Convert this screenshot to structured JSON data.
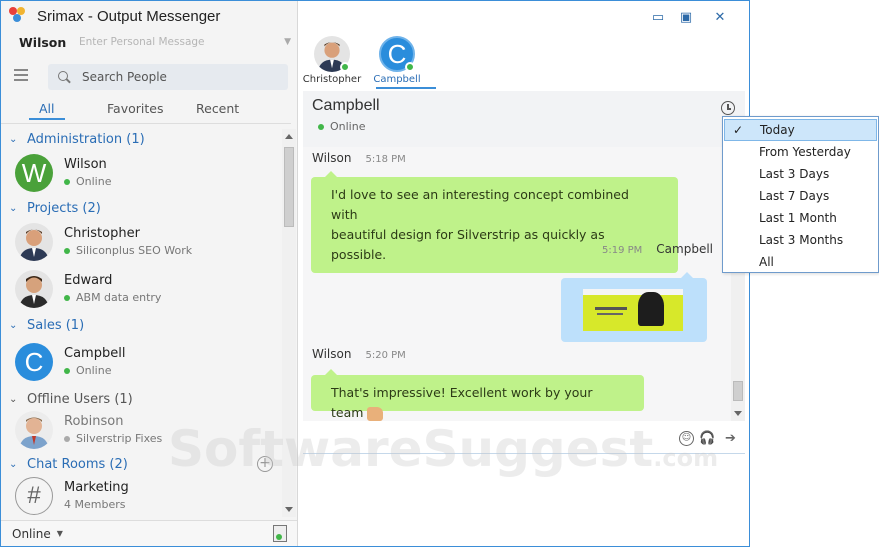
{
  "app": {
    "title": "Srimax - Output Messenger"
  },
  "user": {
    "name": "Wilson",
    "personal_message_placeholder": "Enter Personal Message"
  },
  "search": {
    "placeholder": "Search People"
  },
  "tabs": [
    "All",
    "Favorites",
    "Recent"
  ],
  "groups": [
    {
      "label": "Administration (1)"
    },
    {
      "label": "Projects (2)"
    },
    {
      "label": "Sales (1)"
    },
    {
      "label": "Offline Users (1)"
    },
    {
      "label": "Chat Rooms (2)"
    }
  ],
  "contacts": [
    {
      "name": "Wilson",
      "status": "Online",
      "initial": "W"
    },
    {
      "name": "Christopher",
      "status": "Siliconplus SEO Work"
    },
    {
      "name": "Edward",
      "status": "ABM data entry"
    },
    {
      "name": "Campbell",
      "status": "Online",
      "initial": "C"
    },
    {
      "name": "Robinson",
      "status": "Silverstrip Fixes"
    },
    {
      "name": "Marketing",
      "status": "4 Members",
      "initial": "#"
    }
  ],
  "footer": {
    "status": "Online"
  },
  "chat_tabs": [
    "Christopher",
    "Campbell"
  ],
  "chat": {
    "name": "Campbell",
    "status": "Online",
    "messages": [
      {
        "sender": "Wilson",
        "time": "5:18 PM",
        "text_line1": "I'd love to see an interesting concept combined with",
        "text_line2": "beautiful design for Silverstrip as quickly as possible."
      },
      {
        "sender": "Campbell",
        "time": "5:19 PM"
      },
      {
        "sender": "Wilson",
        "time": "5:20 PM",
        "text": "That's impressive! Excellent work by your team"
      }
    ]
  },
  "history_menu": {
    "items": [
      "Today",
      "From Yesterday",
      "Last 3 Days",
      "Last 7 Days",
      "Last 1 Month",
      "Last 3 Months",
      "All"
    ],
    "selected": "Today"
  },
  "watermark": {
    "text": "SoftwareSuggest",
    "suffix": ".com"
  },
  "colors": {
    "accent": "#2a6db5",
    "online": "#41b649",
    "bubble_green": "#bff28a",
    "bubble_blue": "#bde0fb"
  },
  "icons": [
    "app-logo-icon",
    "menu-icon",
    "search-icon",
    "clock-icon",
    "emoji-icon",
    "headset-icon",
    "send-icon",
    "minimize-icon",
    "maximize-icon",
    "close-icon",
    "add-icon",
    "check-icon"
  ]
}
